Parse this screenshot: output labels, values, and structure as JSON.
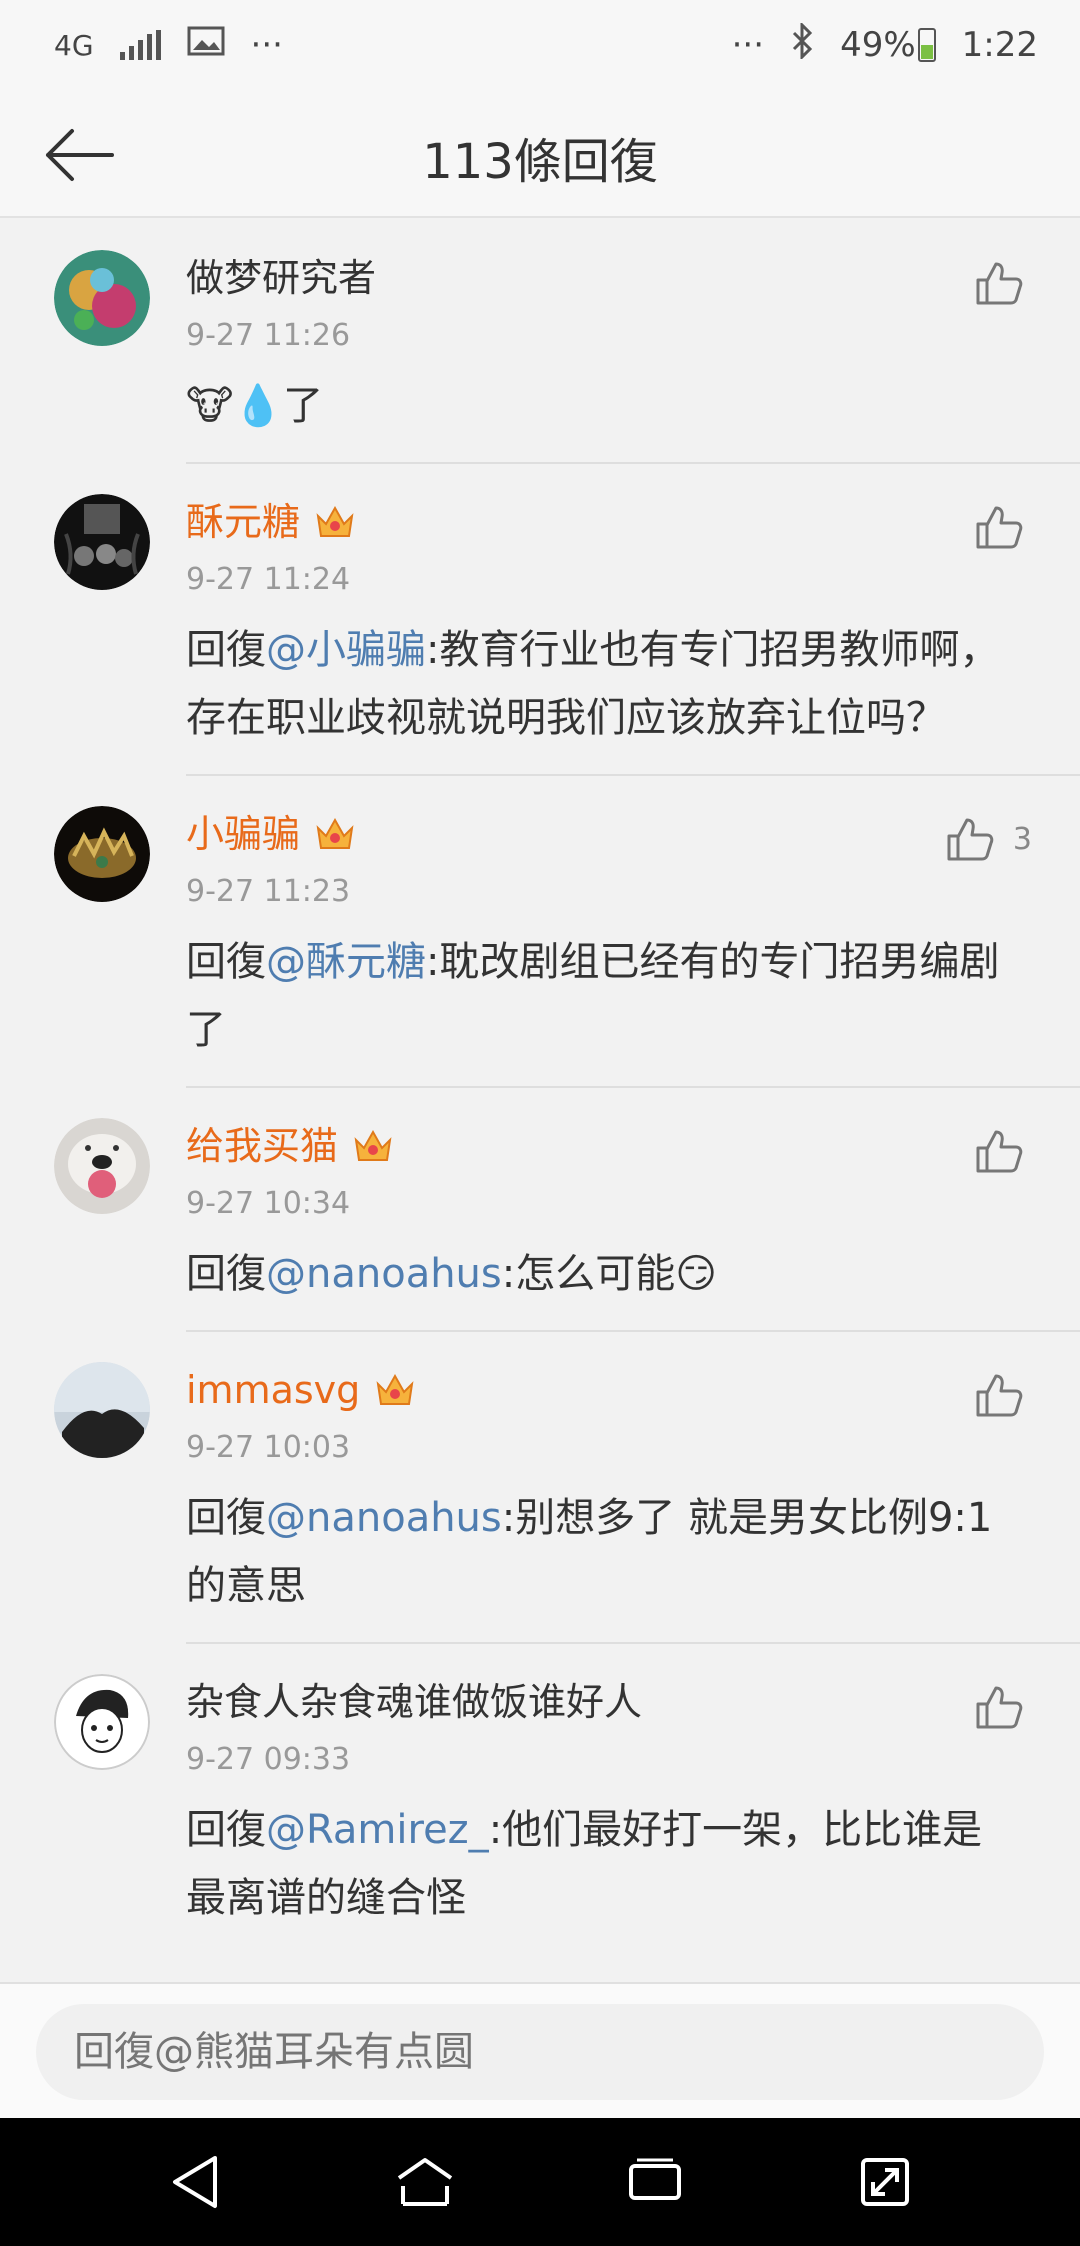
{
  "status": {
    "network": "4G",
    "dots_left": "···",
    "dots_right": "···",
    "battery": "49%",
    "time": "1:22"
  },
  "header": {
    "title": "113條回復"
  },
  "comments": [
    {
      "name": "做梦研究者",
      "time": "9-27 11:26",
      "vip": false,
      "body": "🐮💧了",
      "mention": "",
      "likes": ""
    },
    {
      "name": "酥元糖",
      "time": "9-27 11:24",
      "vip": true,
      "prefix": "回復",
      "mention": "@小骗骗",
      "body": ":教育行业也有专门招男教师啊，存在职业歧视就说明我们应该放弃让位吗？",
      "likes": ""
    },
    {
      "name": "小骗骗",
      "time": "9-27 11:23",
      "vip": true,
      "prefix": "回復",
      "mention": "@酥元糖",
      "body": ":耽改剧组已经有的专门招男编剧了",
      "likes": "3"
    },
    {
      "name": "给我买猫",
      "time": "9-27 10:34",
      "vip": true,
      "prefix": "回復",
      "mention": "@nanoahus",
      "body": ":怎么可能😏",
      "likes": ""
    },
    {
      "name": "immasvg",
      "time": "9-27 10:03",
      "vip": true,
      "prefix": "回復",
      "mention": "@nanoahus",
      "body": ":别想多了 就是男女比例9:1的意思",
      "likes": ""
    },
    {
      "name": "杂食人杂食魂谁做饭谁好人",
      "time": "9-27 09:33",
      "vip": false,
      "prefix": "回復",
      "mention": "@Ramirez_",
      "body": ":他们最好打一架，比比谁是最离谱的缝合怪",
      "likes": ""
    }
  ],
  "input": {
    "placeholder": "回復@熊猫耳朵有点圆"
  },
  "colors": {
    "vip_name": "#e86a1a",
    "mention": "#4f7db0",
    "battery_fill": "#7bc043"
  }
}
